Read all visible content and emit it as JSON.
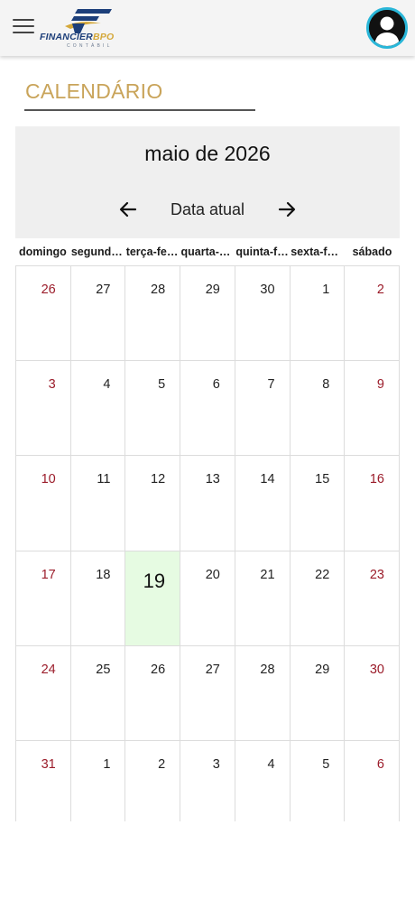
{
  "header": {
    "logo_text_a": "FINANCIER",
    "logo_text_b": "BPO",
    "logo_subtext": "CONTÁBIL",
    "menu_icon": "hamburger-menu-icon",
    "avatar_icon": "user-silhouette-icon"
  },
  "colors": {
    "title": "#c9a45a",
    "weekend": "#9b1c2a",
    "today_bg": "#e6fbe2",
    "avatar_ring": "#29b6d8",
    "logo_blue": "#1d3f7a",
    "logo_gold": "#d4a83a"
  },
  "page": {
    "title": "CALENDÁRIO"
  },
  "calendar": {
    "month_label": "maio de 2026",
    "today_button": "Data atual",
    "prev_icon": "arrow-left-icon",
    "next_icon": "arrow-right-icon",
    "weekdays": [
      "domingo",
      "segunda-feira",
      "terça-feira",
      "quarta-feira",
      "quinta-feira",
      "sexta-feira",
      "sábado"
    ],
    "weeks": [
      [
        "26",
        "27",
        "28",
        "29",
        "30",
        "1",
        "2"
      ],
      [
        "3",
        "4",
        "5",
        "6",
        "7",
        "8",
        "9"
      ],
      [
        "10",
        "11",
        "12",
        "13",
        "14",
        "15",
        "16"
      ],
      [
        "17",
        "18",
        "19",
        "20",
        "21",
        "22",
        "23"
      ],
      [
        "24",
        "25",
        "26",
        "27",
        "28",
        "29",
        "30"
      ],
      [
        "31",
        "1",
        "2",
        "3",
        "4",
        "5",
        "6"
      ]
    ],
    "today": "19"
  }
}
